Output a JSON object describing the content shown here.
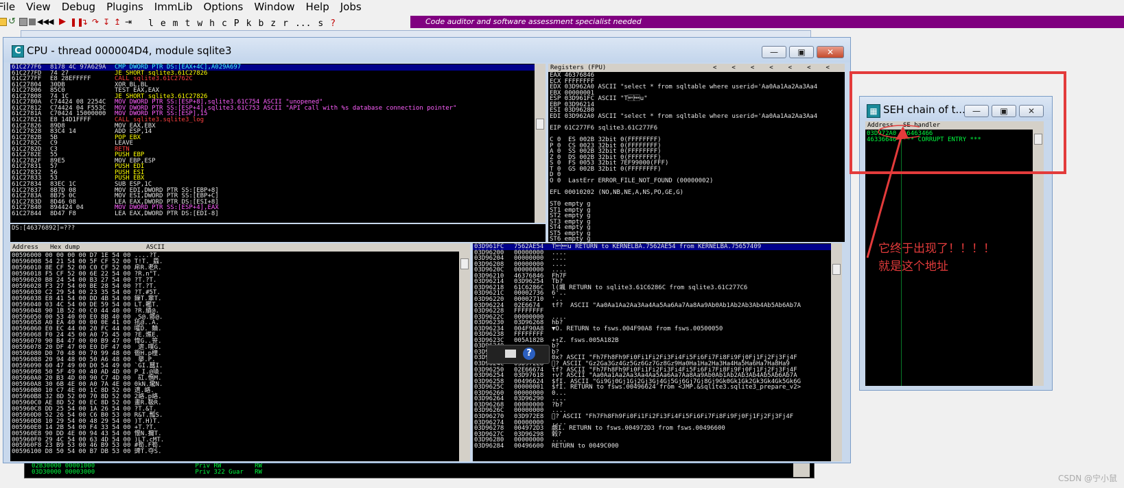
{
  "menu": [
    "File",
    "View",
    "Debug",
    "Plugins",
    "ImmLib",
    "Options",
    "Window",
    "Help",
    "Jobs"
  ],
  "toolbar_letters": [
    "l",
    "e",
    "m",
    "t",
    "w",
    "h",
    "c",
    "P",
    "k",
    "b",
    "z",
    "r",
    "...",
    "s",
    "?"
  ],
  "banner_text": "Code auditor and software assessment specialist needed",
  "cpu_window": {
    "title": "CPU - thread 000004D4, module sqlite3",
    "icon_letter": "C",
    "disasm": [
      {
        "addr": "61C277F6",
        "hex": "8178 4C 97A629A",
        "ins": "CMP DWORD PTR DS:[EAX+4C],A029A697",
        "cls": "c-cyan",
        "sel": true
      },
      {
        "addr": "61C277FD",
        "hex": "74 27",
        "ins": "JE SHORT sqlite3.61C27826",
        "cls": "c-yel"
      },
      {
        "addr": "61C277FF",
        "hex": "E8 28EFFFFF",
        "ins": "CALL sqlite3.61C2762C",
        "cls": "c-red"
      },
      {
        "addr": "61C27804",
        "hex": "30DB",
        "ins": "XOR BL,BL",
        "cls": "c-white"
      },
      {
        "addr": "61C27806",
        "hex": "85C0",
        "ins": "TEST EAX,EAX",
        "cls": "c-white"
      },
      {
        "addr": "61C27808",
        "hex": "74 1C",
        "ins": "JE SHORT sqlite3.61C27826",
        "cls": "c-yel"
      },
      {
        "addr": "61C2780A",
        "hex": "C74424 08 2254C",
        "ins": "MOV DWORD PTR SS:[ESP+8],sqlite3.61C754 ASCII \"unopened\"",
        "cls": "c-mag"
      },
      {
        "addr": "61C27812",
        "hex": "C74424 04 F553C",
        "ins": "MOV DWORD PTR SS:[ESP+4],sqlite3.61C753 ASCII \"API call with %s database connection pointer\"",
        "cls": "c-mag"
      },
      {
        "addr": "61C2781A",
        "hex": "C70424 15000000",
        "ins": "MOV DWORD PTR SS:[ESP],15",
        "cls": "c-mag"
      },
      {
        "addr": "61C27821",
        "hex": "E8 14D1FFFF",
        "ins": "CALL sqlite3.sqlite3_log",
        "cls": "c-red"
      },
      {
        "addr": "61C27826",
        "hex": "89D8",
        "ins": "MOV EAX,EBX",
        "cls": "c-white"
      },
      {
        "addr": "61C27828",
        "hex": "83C4 14",
        "ins": "ADD ESP,14",
        "cls": "c-white"
      },
      {
        "addr": "61C2782B",
        "hex": "5B",
        "ins": "POP EBX",
        "cls": "c-yel"
      },
      {
        "addr": "61C2782C",
        "hex": "C9",
        "ins": "LEAVE",
        "cls": "c-white"
      },
      {
        "addr": "61C2782D",
        "hex": "C3",
        "ins": "RETN",
        "cls": "c-red"
      },
      {
        "addr": "61C2782E",
        "hex": "55",
        "ins": "PUSH EBP",
        "cls": "c-yel"
      },
      {
        "addr": "61C2782F",
        "hex": "89E5",
        "ins": "MOV EBP,ESP",
        "cls": "c-white"
      },
      {
        "addr": "61C27831",
        "hex": "57",
        "ins": "PUSH EDI",
        "cls": "c-yel"
      },
      {
        "addr": "61C27832",
        "hex": "56",
        "ins": "PUSH ESI",
        "cls": "c-yel"
      },
      {
        "addr": "61C27833",
        "hex": "53",
        "ins": "PUSH EBX",
        "cls": "c-yel"
      },
      {
        "addr": "61C27834",
        "hex": "83EC 1C",
        "ins": "SUB ESP,1C",
        "cls": "c-white"
      },
      {
        "addr": "61C27837",
        "hex": "8B7D 08",
        "ins": "MOV EDI,DWORD PTR SS:[EBP+8]",
        "cls": "c-white"
      },
      {
        "addr": "61C2783A",
        "hex": "8B75 0C",
        "ins": "MOV ESI,DWORD PTR SS:[EBP+C]",
        "cls": "c-white"
      },
      {
        "addr": "61C2783D",
        "hex": "8D46 08",
        "ins": "LEA EAX,DWORD PTR DS:[ESI+8]",
        "cls": "c-white"
      },
      {
        "addr": "61C27840",
        "hex": "894424 04",
        "ins": "MOV DWORD PTR SS:[ESP+4],EAX",
        "cls": "c-mag"
      },
      {
        "addr": "61C27844",
        "hex": "8D47 F8",
        "ins": "LEA EAX,DWORD PTR DS:[EDI-8]",
        "cls": "c-white"
      }
    ],
    "info_line": "DS:[46376892]=???",
    "registers_title": "Registers (FPU)",
    "registers": [
      "EAX 46376846",
      "ECX FFFFFFFF",
      "EDX 03D962A0 ASCII \"select * from sqltable where userid='Aa0Aa1Aa2Aa3Aa4",
      "EBX 00000001",
      "ESP 03D961FC ASCII \"T\u0019\u0015u\"",
      "EBP 03D96214",
      "ESI 03D96280",
      "EDI 03D962A0 ASCII \"select * from sqltable where userid='Aa0Aa1Aa2Aa3Aa4",
      "",
      "EIP 61C277F6 sqlite3.61C277F6",
      "",
      "C 0  ES 002B 32bit 0(FFFFFFFF)",
      "P 0  CS 0023 32bit 0(FFFFFFFF)",
      "A 0  SS 002B 32bit 0(FFFFFFFF)",
      "Z 0  DS 002B 32bit 0(FFFFFFFF)",
      "S 0  FS 0053 32bit 7EF99000(FFF)",
      "T 0  GS 002B 32bit 0(FFFFFFFF)",
      "D 0",
      "O 0  LastErr ERROR_FILE_NOT_FOUND (00000002)",
      "",
      "EFL 00010202 (NO,NB,NE,A,NS,PO,GE,G)",
      "",
      "ST0 empty g",
      "ST1 empty g",
      "ST2 empty g",
      "ST3 empty g",
      "ST4 empty g",
      "ST5 empty g",
      "ST6 empty g",
      "ST7 empty g"
    ],
    "hexdump_headers": [
      "Address",
      "Hex dump",
      "ASCII"
    ],
    "hexdump": [
      "00596000 00 00 00 00 D7 1E 54 00 ....?T.",
      "00596008 54 21 54 00 5F CF 52 00 T!T._蟁.",
      "00596010 8E CF 52 00 C0 CF 52 00 帍R.老R.",
      "00596018 F5 CF 52 00 6E 22 54 00 ?R.n\"T.",
      "00596020 B8 24 54 00 B3 27 54 00 ?T.?T.",
      "00596028 F3 27 54 00 BE 28 54 00 ?T.?T.",
      "00596030 C2 29 54 00 23 35 54 00 ?T.#5T.",
      "00596038 E8 41 54 00 DD 4B 54 00 鐰T.軰T.",
      "00596040 03 4C 54 00 DE 59 54 00 LT.轞T.",
      "00596048 90 1B 52 00 C0 44 40 00 ?R.繢@.",
      "00596050 00 53 40 00 E0 8B 40 00 .S@.鄫@.",
      "00596058 A0 EA 40 00 00 0E 41 00 犼@..A.",
      "00596060 E0 EC 44 00 20 FC 44 00 嚯D. 麯.",
      "00596068 F0 24 45 00 A0 75 45 00 ?E.爑E.",
      "00596070 90 B4 47 00 00 B9 47 00 愇G..笹.",
      "00596078 20 DF 47 00 E0 DF 47 00  逩.噗G.",
      "00596080 D0 70 48 00 70 99 48 00 衟H.p橦.",
      "00596088 20 94 48 00 50 A6 48 00  擧.P.",
      "00596090 60 47 49 00 D0 54 49 00 `GI.蠺I.",
      "00596098 50 5F 49 00 40 AD 4D 00 P_I.@璏.",
      "005960A0 20 B3 4D 00 90 C7 4D 00  矼.惽M.",
      "005960A8 30 6B 4E 00 A0 7A 4E 00 0kN.爖N.",
      "005960B0 10 C7 4E 00 1C 8D 52 00 逳.峈.",
      "005960B8 32 8D 52 00 70 8D 52 00 2峈.p峈.",
      "005960C0 AE 8D 52 00 EC 8D 52 00 畫R.靸R.",
      "005960C8 DD 25 54 00 1A 26 54 00 ?T.&T.",
      "005960D0 52 26 54 00 C6 B0 53 00 R&T.瓢S.",
      "005960D8 10 29 54 00 48 29 54 00 )T.H)T.",
      "005960E0 14 2B 54 00 F4 33 54 00 +T.?T.",
      "005960E8 90 DD 4E 00 94 43 54 00 愝N.擟T.",
      "005960F0 29 4C 54 00 63 4D 54 00 )LT.cMT.",
      "005960F8 23 B9 53 00 46 B9 53 00 #筍.F筍.",
      "00596100 D8 50 54 00 B7 DB 53 00 豍T.夺S."
    ],
    "stack": [
      {
        "addr": "03D961FC",
        "val": "7562AE54",
        "txt": "T\u0019\u0015u RETURN to KERNELBA.7562AE54 from KERNELBA.75657409",
        "sel": true
      },
      {
        "addr": "03D96200",
        "val": "00000000",
        "txt": "...."
      },
      {
        "addr": "03D96204",
        "val": "00000000",
        "txt": "...."
      },
      {
        "addr": "03D96208",
        "val": "00000000",
        "txt": "...."
      },
      {
        "addr": "03D9620C",
        "val": "00000000",
        "txt": "...."
      },
      {
        "addr": "03D96210",
        "val": "46376846",
        "txt": "Fh7F"
      },
      {
        "addr": "03D96214",
        "val": "03D96254",
        "txt": "Tb?"
      },
      {
        "addr": "03D96218",
        "val": "61C6286C",
        "txt": "l(颯 RETURN to sqlite3.61C6286C from sqlite3.61C277C6"
      },
      {
        "addr": "03D9621C",
        "val": "00002736",
        "txt": "6'.."
      },
      {
        "addr": "03D96220",
        "val": "00002710",
        "txt": "'.."
      },
      {
        "addr": "03D96224",
        "val": "02E6674",
        "txt": "tf?  ASCII \"Aa0Aa1Aa2Aa3Aa4Aa5Aa6Aa7Aa8Aa9Ab0Ab1Ab2Ab3Ab4Ab5Ab6Ab7A"
      },
      {
        "addr": "03D96228",
        "val": "FFFFFFFF",
        "txt": ""
      },
      {
        "addr": "03D9622C",
        "val": "00000000",
        "txt": "...."
      },
      {
        "addr": "03D96230",
        "val": "03D96268",
        "txt": "hb?"
      },
      {
        "addr": "03D96234",
        "val": "004F90A8",
        "txt": "▼O. RETURN to fsws.004F90A8 from fsws.00500050"
      },
      {
        "addr": "03D96238",
        "val": "FFFFFFFF",
        "txt": ""
      },
      {
        "addr": "03D9623C",
        "val": "005A182B",
        "txt": "+↑Z. fsws.005A182B"
      },
      {
        "addr": "03D96240",
        "val": "",
        "txt": "b?"
      },
      {
        "addr": "03D96244",
        "val": "",
        "txt": "b?"
      },
      {
        "addr": "03D96248",
        "val": "",
        "txt": "0x? ASCII \"Fh7Fh8Fh9Fi0Fi1Fi2Fi3Fi4Fi5Fi6Fi7Fi8Fi9Fj0Fj1Fj2Fj3Fj4F"
      },
      {
        "addr": "03D9624C",
        "val": "03D972E8",
        "txt": "\u0000? ASCII \"Gz2Ga3Gz4Gz5Gz6Gz7Gz8Gz9Ha0Ha1Ha2Ha3Ha4Ha5Ha6Ha7Ha8Ha9"
      },
      {
        "addr": "03D96250",
        "val": "02E66674",
        "txt": "tf? ASCII \"Fh7Fh8Fh9Fi0Fi1Fi2Fi3Fi4Fi5Fi6Fi7Fi8Fi9Fj0Fj1Fj2Fj3Fj4F"
      },
      {
        "addr": "03D96254",
        "val": "03D97618",
        "txt": "↑v? ASCII \"Aa0Aa1Aa2Aa3Aa4Aa5Aa6Aa7Aa8Aa9Ab0Ab1Ab2Ab3Ab4Ab5Ab6Ab7A"
      },
      {
        "addr": "03D96258",
        "val": "00496624",
        "txt": "$fI. ASCII \"Gi9Gj0Gj1Gj2Gj3Gj4Gj5Gj6Gj7Gj8Gj9Gk0Gk1Gk2Gk3Gk4Gk5Gk6G"
      },
      {
        "addr": "03D9625C",
        "val": "00000001",
        "txt": "$fI. RETURN to fsws.00496624 from <JMP.&sqlite3.sqlite3_prepare_v2>"
      },
      {
        "addr": "03D96260",
        "val": "00000000",
        "txt": "0..."
      },
      {
        "addr": "03D96264",
        "val": "03D96290",
        "txt": "...."
      },
      {
        "addr": "03D96268",
        "val": "00000000",
        "txt": "?b?"
      },
      {
        "addr": "03D9626C",
        "val": "00000000",
        "txt": "...."
      },
      {
        "addr": "03D96270",
        "val": "03D972E8",
        "txt": "\u0000? ASCII \"Fh7Fh8Fh9Fi0Fi1Fi2Fi3Fi4Fi5Fi6Fi7Fi8Fi9Fj0Fj1Fj2Fj3Fj4F"
      },
      {
        "addr": "03D96274",
        "val": "00000000",
        "txt": "...."
      },
      {
        "addr": "03D96278",
        "val": "004972D3",
        "txt": "覷I. RETURN to fsws.004972D3 from fsws.00496600"
      },
      {
        "addr": "03D9627C",
        "val": "03D96298",
        "txt": "榖?"
      },
      {
        "addr": "03D96280",
        "val": "00000000",
        "txt": "...."
      },
      {
        "addr": "03D96284",
        "val": "00496600",
        "txt": "RETURN to 0049C000"
      }
    ]
  },
  "background_rows": [
    "02B30000 00001000                           Priv RW         RW",
    "03D30000 00003000                           Priv 322 Guar   RW"
  ],
  "seh_window": {
    "title": "SEH chain of t...",
    "headers": [
      "Address",
      "SE handler"
    ],
    "rows": [
      {
        "address": "03D972A0",
        "handler": "66463466"
      },
      {
        "address": "46336646",
        "handler": "*** CORRUPT ENTRY ***"
      }
    ]
  },
  "annotation": {
    "line1": "它终于出现了！！！！",
    "line2": "就是这个地址",
    "color": "#e33b3b"
  },
  "watermark": "CSDN @宁小鼠"
}
